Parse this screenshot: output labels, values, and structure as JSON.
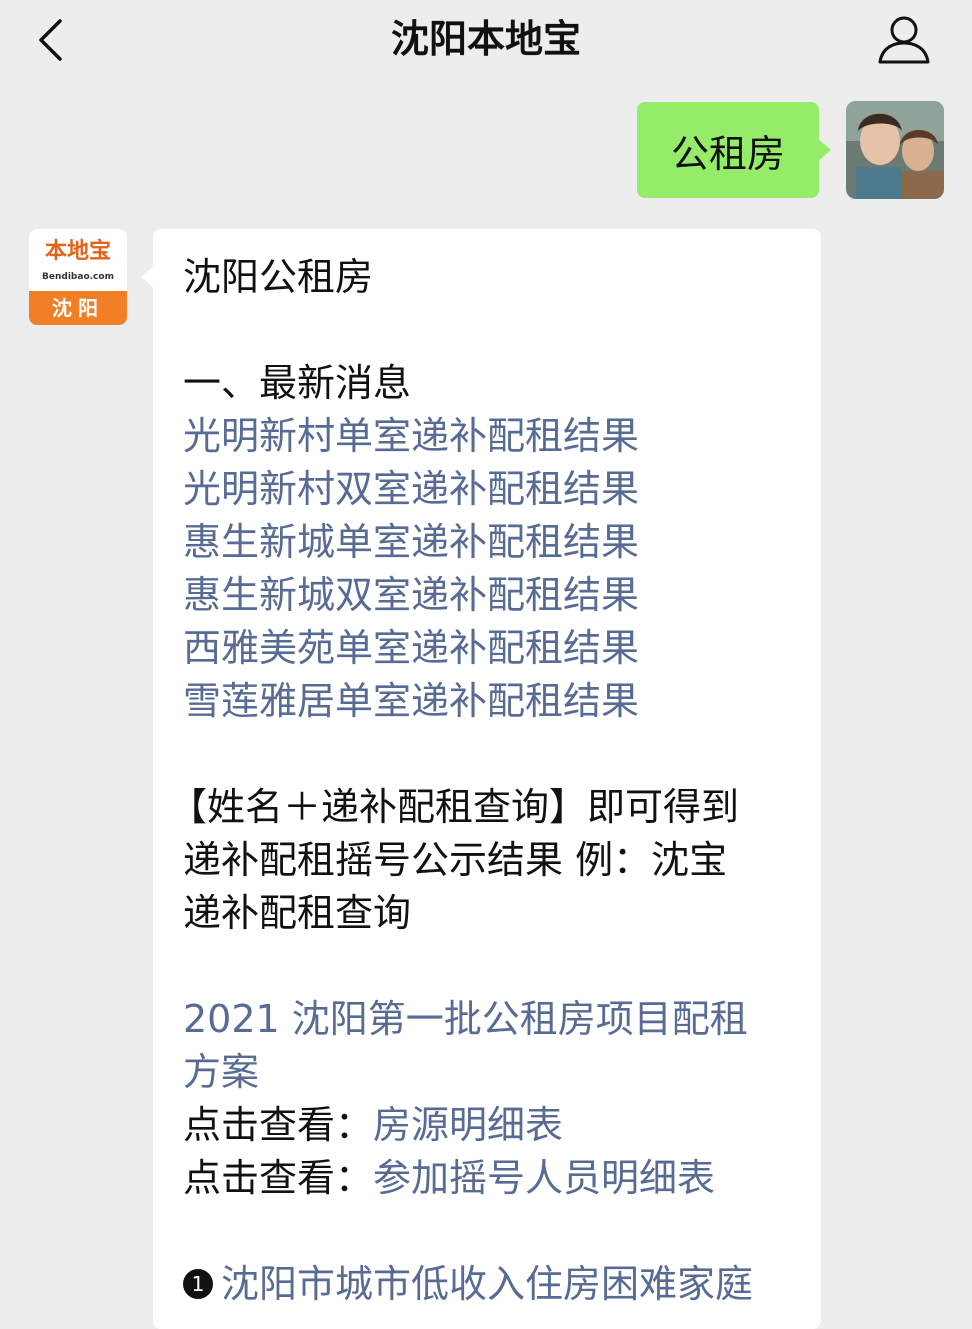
{
  "header": {
    "title": "沈阳本地宝"
  },
  "outgoing": {
    "text": "公租房"
  },
  "bot": {
    "logo_text": "本地宝",
    "logo_sub": "Bendibao.com",
    "logo_city": "沈阳"
  },
  "message": {
    "title": "沈阳公租房",
    "section1": "一、最新消息",
    "links": [
      "光明新村单室递补配租结果",
      "光明新村双室递补配租结果",
      "惠生新城单室递补配租结果",
      "惠生新城双室递补配租结果",
      "西雅美苑单室递补配租结果",
      "雪莲雅居单室递补配租结果"
    ],
    "query_lines": [
      "【姓名＋递补配租查询】即可得到",
      "递补配租摇号公示结果 例：沈宝",
      "递补配租查询"
    ],
    "plan_link_lines": [
      "2021 沈阳第一批公租房项目配租",
      "方案"
    ],
    "view_rows": [
      {
        "prefix": "点击查看：",
        "link": "房源明细表"
      },
      {
        "prefix": "点击查看：",
        "link": "参加摇号人员明细表"
      }
    ],
    "numbered_item": {
      "number": "1",
      "text": "沈阳市城市低收入住房困难家庭"
    }
  }
}
